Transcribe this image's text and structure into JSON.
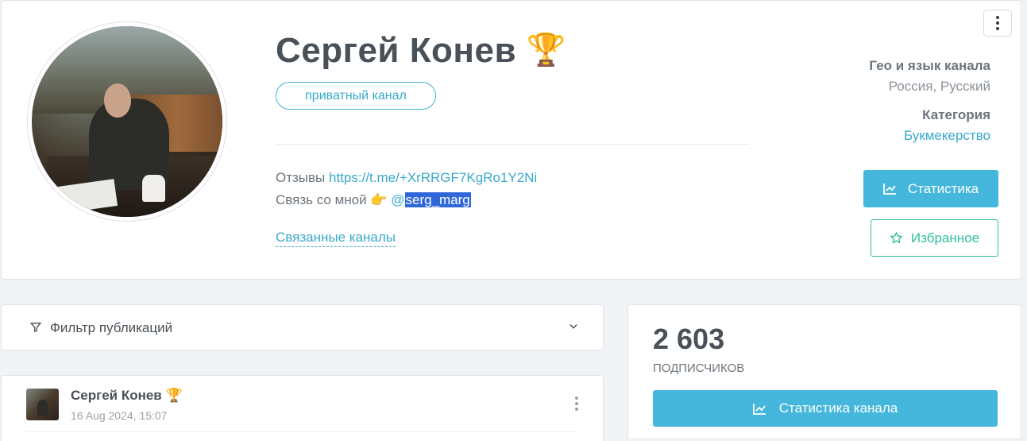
{
  "profile": {
    "title": "Сергей Конев",
    "title_emoji": "🏆",
    "badge": "приватный канал",
    "reviews_label": "Отзывы",
    "reviews_link": "https://t.me/+XrRRGF7KgRo1Y2Ni",
    "contact_label": "Связь со мной",
    "contact_emoji": "👉",
    "contact_at": "@",
    "contact_handle": "serg_marg",
    "related_channels": "Связанные каналы"
  },
  "meta": {
    "geo_label": "Гео и язык канала",
    "geo_value": "Россия, Русский",
    "category_label": "Категория",
    "category_value": "Букмекерство"
  },
  "actions": {
    "stats_label": "Статистика",
    "favorite_label": "Избранное"
  },
  "filter": {
    "label": "Фильтр публикаций"
  },
  "post": {
    "author": "Сергей Конев",
    "author_emoji": "🏆",
    "date": "16 Aug 2024, 15:07"
  },
  "subscribers": {
    "count": "2 603",
    "label": "подписчиков",
    "stats_button": "Статистика канала"
  },
  "colors": {
    "accent": "#45b6dc",
    "link": "#3aa9cc",
    "favorite": "#2fbf9e",
    "selection": "#2f66d8"
  },
  "icons": [
    "more-vertical-icon",
    "chart-line-icon",
    "star-outline-icon",
    "filter-icon",
    "chevron-down-icon"
  ]
}
